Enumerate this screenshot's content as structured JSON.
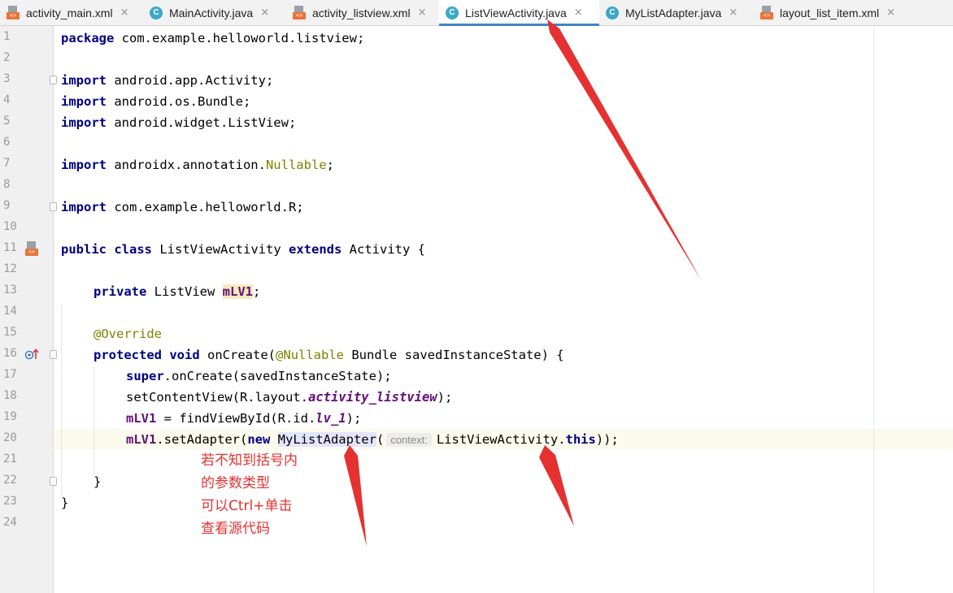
{
  "tabs": [
    {
      "label": "activity_main.xml",
      "type": "xml",
      "active": false,
      "close": "×"
    },
    {
      "label": "MainActivity.java",
      "type": "java",
      "active": false,
      "close": "×"
    },
    {
      "label": "activity_listview.xml",
      "type": "xml",
      "active": false,
      "close": "×"
    },
    {
      "label": "ListViewActivity.java",
      "type": "java",
      "active": true,
      "close": "×"
    },
    {
      "label": "MyListAdapter.java",
      "type": "java",
      "active": false,
      "close": "×"
    },
    {
      "label": "layout_list_item.xml",
      "type": "xml",
      "active": false,
      "close": "×"
    }
  ],
  "icons": {
    "java_letter": "C",
    "xml_badge": "<>",
    "gutter_override": "override-up-arrow-icon",
    "gutter_class": "layout-xml-icon"
  },
  "colors": {
    "keyword": "#000080",
    "annotation": "#808000",
    "field": "#660e7a",
    "annotation_red": "#e63131",
    "tab_accent": "#4083c9"
  },
  "code": {
    "l1_kw": "package",
    "l1_rest": " com.example.helloworld.listview;",
    "l3_kw": "import",
    "l3_rest": " android.app.Activity;",
    "l4_kw": "import",
    "l4_rest": " android.os.Bundle;",
    "l5_kw": "import",
    "l5_rest": " android.widget.ListView;",
    "l7_kw": "import",
    "l7_rest": " androidx.annotation.",
    "l7_ann": "Nullable",
    "l7_end": ";",
    "l9_kw": "import",
    "l9_rest": " com.example.helloworld.R;",
    "l11_kw1": "public",
    "l11_kw2": "class",
    "l11_name": " ListViewActivity ",
    "l11_kw3": "extends",
    "l11_rest": " Activity {",
    "l13_kw": "private",
    "l13_type": " ListView ",
    "l13_field": "mLV1",
    "l13_end": ";",
    "l15_ann": "@Override",
    "l16_kw1": "protected",
    "l16_kw2": "void",
    "l16_m": " onCreate(",
    "l16_ann": "@Nullable",
    "l16_rest": " Bundle savedInstanceState) {",
    "l17_kw": "super",
    "l17_rest": ".onCreate(savedInstanceState);",
    "l18_a": "setContentView(R.layout.",
    "l18_field": "activity_listview",
    "l18_b": ");",
    "l19_field": "mLV1",
    "l19_a": " = findViewById(R.id.",
    "l19_id": "lv_1",
    "l19_b": ");",
    "l20_field": "mLV1",
    "l20_a": ".setAdapter(",
    "l20_kw": "new",
    "l20_sp": " ",
    "l20_cls": "MyListAdapter",
    "l20_paren": "(",
    "l20_hint": "context:",
    "l20_arg": "ListViewActivity.",
    "l20_kw2": "this",
    "l20_end": "));",
    "l22": "}",
    "l23": "}"
  },
  "line_numbers": [
    "1",
    "2",
    "3",
    "4",
    "5",
    "6",
    "7",
    "8",
    "9",
    "10",
    "11",
    "12",
    "13",
    "14",
    "15",
    "16",
    "17",
    "18",
    "19",
    "20",
    "21",
    "22",
    "23",
    "24"
  ],
  "annotation": {
    "line1": "若不知到括号内",
    "line2": "的参数类型",
    "line3": "可以Ctrl+单击",
    "line4": "查看源代码"
  }
}
